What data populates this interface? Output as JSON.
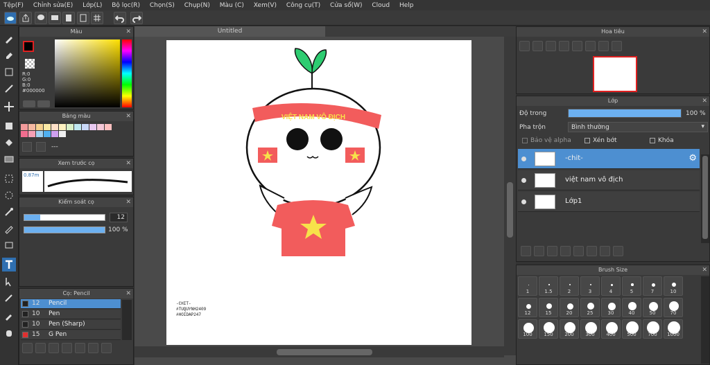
{
  "menu": [
    "Tệp(F)",
    "Chỉnh sửa(E)",
    "Lớp(L)",
    "Bộ lọc(R)",
    "Chọn(S)",
    "Chụp(N)",
    "Màu (C)",
    "Xem(V)",
    "Công cụ(T)",
    "Cửa sổ(W)",
    "Cloud",
    "Help"
  ],
  "panels": {
    "color": "Màu",
    "palette": "Bảng màu",
    "brush_preview": "Xem trước cọ",
    "brush_control": "Kiểm soát cọ",
    "brush_list": "Cọ: Pencil",
    "navigator": "Hoa tiêu",
    "layers": "Lớp",
    "brush_size": "Brush Size"
  },
  "color": {
    "r": "R:0",
    "g": "G:0",
    "b": "B:0",
    "hex": "#000000"
  },
  "palette_dash": "---",
  "brush_preview_size": "0.87m",
  "brush_control": {
    "size": "12",
    "opacity": "100 %",
    "size_fraction": 0.2,
    "opacity_fraction": 1.0
  },
  "brushes": [
    {
      "size": "12",
      "name": "Pencil",
      "color": "#222222",
      "selected": true
    },
    {
      "size": "10",
      "name": "Pen",
      "color": "#222222",
      "selected": false
    },
    {
      "size": "10",
      "name": "Pen (Sharp)",
      "color": "#222222",
      "selected": false
    },
    {
      "size": "15",
      "name": "G Pen",
      "color": "#e03030",
      "selected": false
    }
  ],
  "canvas": {
    "tab": "Untitled",
    "headband_text": "VIỆT NAM VÔ ĐỊCH",
    "signature": [
      "-CHIT-",
      "#TUQUYNH2409",
      "#HOIDAP247"
    ]
  },
  "layers": {
    "opacity_label": "Độ trong",
    "opacity_value": "100 %",
    "blend_label": "Pha trộn",
    "blend_value": "Bình thường",
    "protect_alpha": "Bảo vệ alpha",
    "clipping": "Xén bớt",
    "lock": "Khóa",
    "items": [
      {
        "name": "-chit-",
        "selected": true
      },
      {
        "name": "việt nam vô địch",
        "selected": false
      },
      {
        "name": "Lớp1",
        "selected": false
      }
    ]
  },
  "brush_sizes": [
    "1",
    "1.5",
    "2",
    "3",
    "4",
    "5",
    "7",
    "10",
    "12",
    "15",
    "20",
    "25",
    "30",
    "40",
    "50",
    "70",
    "100",
    "150",
    "200",
    "300",
    "400",
    "500",
    "700",
    "1000"
  ],
  "accent": "#4d8fd1"
}
